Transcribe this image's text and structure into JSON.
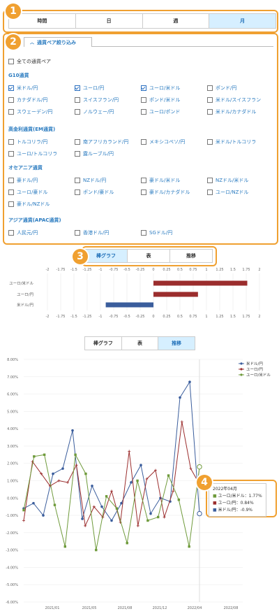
{
  "callouts": [
    "1",
    "2",
    "3",
    "4"
  ],
  "period_tabs": [
    {
      "label": "時間",
      "active": false
    },
    {
      "label": "日",
      "active": false
    },
    {
      "label": "週",
      "active": false
    },
    {
      "label": "月",
      "active": true
    }
  ],
  "filter": {
    "tab_label": "通貨ペア絞り込み",
    "all_label": "全ての通貨ペア",
    "groups": [
      {
        "title": "G10通貨",
        "items": [
          {
            "label": "米ドル/円",
            "checked": true
          },
          {
            "label": "ユーロ/円",
            "checked": true
          },
          {
            "label": "ユーロ/米ドル",
            "checked": true
          },
          {
            "label": "ポンド/円",
            "checked": false
          },
          {
            "label": "カナダドル/円",
            "checked": false
          },
          {
            "label": "スイスフラン/円",
            "checked": false
          },
          {
            "label": "ポンド/米ドル",
            "checked": false
          },
          {
            "label": "米ドル/スイスフラン",
            "checked": false
          },
          {
            "label": "スウェーデン/円",
            "checked": false
          },
          {
            "label": "ノルウェー/円",
            "checked": false
          },
          {
            "label": "ユーロ/ポンド",
            "checked": false
          },
          {
            "label": "米ドル/カナダドル",
            "checked": false
          }
        ]
      },
      {
        "title": "高金利通貨(EM通貨)",
        "items": [
          {
            "label": "トルコリラ/円",
            "checked": false
          },
          {
            "label": "南アフリカランド/円",
            "checked": false
          },
          {
            "label": "メキシコペソ/円",
            "checked": false
          },
          {
            "label": "米ドル/トルコリラ",
            "checked": false
          },
          {
            "label": "ユーロ/トルコリラ",
            "checked": false
          },
          {
            "label": "露ルーブル/円",
            "checked": false
          }
        ]
      },
      {
        "title": "オセアニア通貨",
        "items": [
          {
            "label": "豪ドル/円",
            "checked": false
          },
          {
            "label": "NZドル/円",
            "checked": false
          },
          {
            "label": "豪ドル/米ドル",
            "checked": false
          },
          {
            "label": "NZドル/米ドル",
            "checked": false
          },
          {
            "label": "ユーロ/豪ドル",
            "checked": false
          },
          {
            "label": "ポンド/豪ドル",
            "checked": false
          },
          {
            "label": "豪ドル/カナダドル",
            "checked": false
          },
          {
            "label": "ユーロ/NZドル",
            "checked": false
          },
          {
            "label": "豪ドル/NZドル",
            "checked": false
          }
        ]
      },
      {
        "title": "アジア通貨(APAC通貨)",
        "items": [
          {
            "label": "人民元/円",
            "checked": false
          },
          {
            "label": "香港ドル/円",
            "checked": false
          },
          {
            "label": "SGドル/円",
            "checked": false
          }
        ]
      }
    ]
  },
  "view_tabs_top": [
    {
      "label": "棒グラフ",
      "active": true
    },
    {
      "label": "表",
      "active": false
    },
    {
      "label": "推移",
      "active": false
    }
  ],
  "view_tabs_bottom": [
    {
      "label": "棒グラフ",
      "active": false
    },
    {
      "label": "表",
      "active": false
    },
    {
      "label": "推移",
      "active": true
    }
  ],
  "colors": {
    "accent": "#f0a030",
    "usd": "#3a5d9c",
    "eur": "#9b2d2d",
    "eurusd": "#6e9a3a"
  },
  "tooltip": {
    "title": "2022年04月",
    "rows": [
      {
        "text": "ユーロ/米ドル：1.77%",
        "color": "#6e9a3a"
      },
      {
        "text": "ユーロ/円：0.84%",
        "color": "#9b2d2d"
      },
      {
        "text": "米ドル/円：-0.9%",
        "color": "#3a5d9c"
      }
    ]
  },
  "chart_data": [
    {
      "type": "bar",
      "orientation": "horizontal",
      "categories": [
        "ユーロ/米ドル",
        "ユーロ/円",
        "米ドル/円"
      ],
      "values": [
        1.77,
        0.84,
        -0.9
      ],
      "colors": [
        "#9b2d2d",
        "#9b2d2d",
        "#3a5d9c"
      ],
      "xlim": [
        -2,
        2
      ],
      "xticks": [
        "-2",
        "-1.75",
        "-1.5",
        "-1.25",
        "-1",
        "-0.75",
        "-0.5",
        "-0.25",
        "0",
        "0.25",
        "0.5",
        "0.75",
        "1",
        "1.25",
        "1.5",
        "1.75",
        "2"
      ]
    },
    {
      "type": "line",
      "x": [
        "2020-12",
        "2021-01",
        "2021-02",
        "2021-03",
        "2021-04",
        "2021-05",
        "2021-06",
        "2021-07",
        "2021-08",
        "2021-09",
        "2021-10",
        "2021-11",
        "2021-12",
        "2022-01",
        "2022-02",
        "2022-03",
        "2022-04"
      ],
      "xticks": [
        "2021/01",
        "2021/05",
        "2021/08",
        "2021/12",
        "2022/04",
        "2022/08"
      ],
      "ylim": [
        -6,
        8
      ],
      "yticks": [
        "8.00%",
        "7.00%",
        "6.00%",
        "5.00%",
        "4.00%",
        "3.00%",
        "2.00%",
        "1.00%",
        "0.00%",
        "-1.00%",
        "-2.00%",
        "-3.00%",
        "-4.00%",
        "-5.00%",
        "-6.00%"
      ],
      "legend_position": "top-right",
      "series": [
        {
          "name": "米ドル/円",
          "color": "#3a5d9c",
          "values": [
            -0.6,
            -0.3,
            -1.0,
            1.4,
            1.7,
            3.9,
            -1.2,
            0.7,
            -0.5,
            -1.3,
            -0.3,
            0.9,
            1.9,
            -0.9,
            0.0,
            -0.2,
            5.8,
            6.7,
            -0.9
          ]
        },
        {
          "name": "ユーロ/円",
          "color": "#9b2d2d",
          "values": [
            -1.3,
            2.1,
            1.4,
            0.7,
            1.0,
            0.9,
            1.9,
            -1.6,
            -0.5,
            -1.1,
            0.4,
            -1.4,
            2.7,
            -1.6,
            1.1,
            1.6,
            -1.1,
            0.4,
            4.4,
            1.7,
            0.8
          ]
        },
        {
          "name": "ユーロ/米ドル",
          "color": "#6e9a3a",
          "values": [
            -0.7,
            2.4,
            2.5,
            -0.4,
            -2.8,
            2.5,
            1.4,
            -3.0,
            0.1,
            -0.6,
            -2.6,
            1.0,
            -1.3,
            -1.1,
            1.3,
            -0.1,
            -2.8,
            1.8
          ]
        }
      ]
    }
  ]
}
